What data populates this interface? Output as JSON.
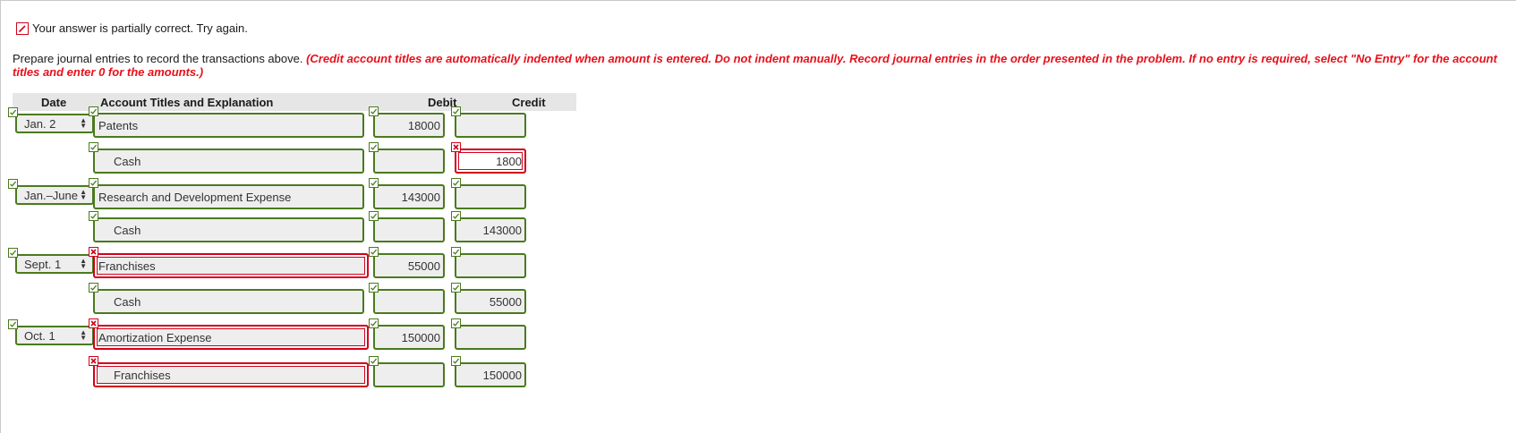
{
  "status": {
    "icon": "pencil-icon",
    "message": "Your answer is partially correct.  Try again."
  },
  "instructions": {
    "lead": "Prepare journal entries to record the transactions above.",
    "note": "(Credit account titles are automatically indented when amount is entered. Do not indent manually. Record journal entries in the order presented in the problem. If no entry is required, select \"No Entry\" for the account titles and enter 0 for the amounts.)"
  },
  "table": {
    "headers": {
      "date": "Date",
      "account": "Account Titles and Explanation",
      "debit": "Debit",
      "credit": "Credit"
    },
    "rows": [
      {
        "date": "Jan. 2",
        "account": "Patents",
        "debit": "18000",
        "credit": "",
        "date_status": "correct",
        "account_status": "correct",
        "debit_status": "correct",
        "credit_status": "correct",
        "indent": false
      },
      {
        "date": "",
        "account": "Cash",
        "debit": "",
        "credit": "1800",
        "account_status": "correct",
        "debit_status": "correct",
        "credit_status": "incorrect",
        "indent": true
      },
      {
        "date": "Jan.–June",
        "account": "Research and Development Expense",
        "debit": "143000",
        "credit": "",
        "date_status": "correct",
        "account_status": "correct",
        "debit_status": "correct",
        "credit_status": "correct",
        "indent": false
      },
      {
        "date": "",
        "account": "Cash",
        "debit": "",
        "credit": "143000",
        "account_status": "correct",
        "debit_status": "correct",
        "credit_status": "correct",
        "indent": true
      },
      {
        "date": "Sept. 1",
        "account": "Franchises",
        "debit": "55000",
        "credit": "",
        "date_status": "correct",
        "account_status": "incorrect",
        "debit_status": "correct",
        "credit_status": "correct",
        "indent": false
      },
      {
        "date": "",
        "account": "Cash",
        "debit": "",
        "credit": "55000",
        "account_status": "correct",
        "debit_status": "correct",
        "credit_status": "correct",
        "indent": true
      },
      {
        "date": "Oct. 1",
        "account": "Amortization Expense",
        "debit": "150000",
        "credit": "",
        "date_status": "correct",
        "account_status": "incorrect",
        "debit_status": "correct",
        "credit_status": "correct",
        "indent": false
      },
      {
        "date": "",
        "account": "Franchises",
        "debit": "",
        "credit": "150000",
        "account_status": "incorrect",
        "debit_status": "correct",
        "credit_status": "correct",
        "indent": true
      }
    ]
  },
  "colors": {
    "correct": "#4a7a1e",
    "incorrect": "#d0021b",
    "instruction_red": "#e8101a",
    "field_bg": "#eeeeee",
    "header_bg": "#e6e6e6"
  }
}
